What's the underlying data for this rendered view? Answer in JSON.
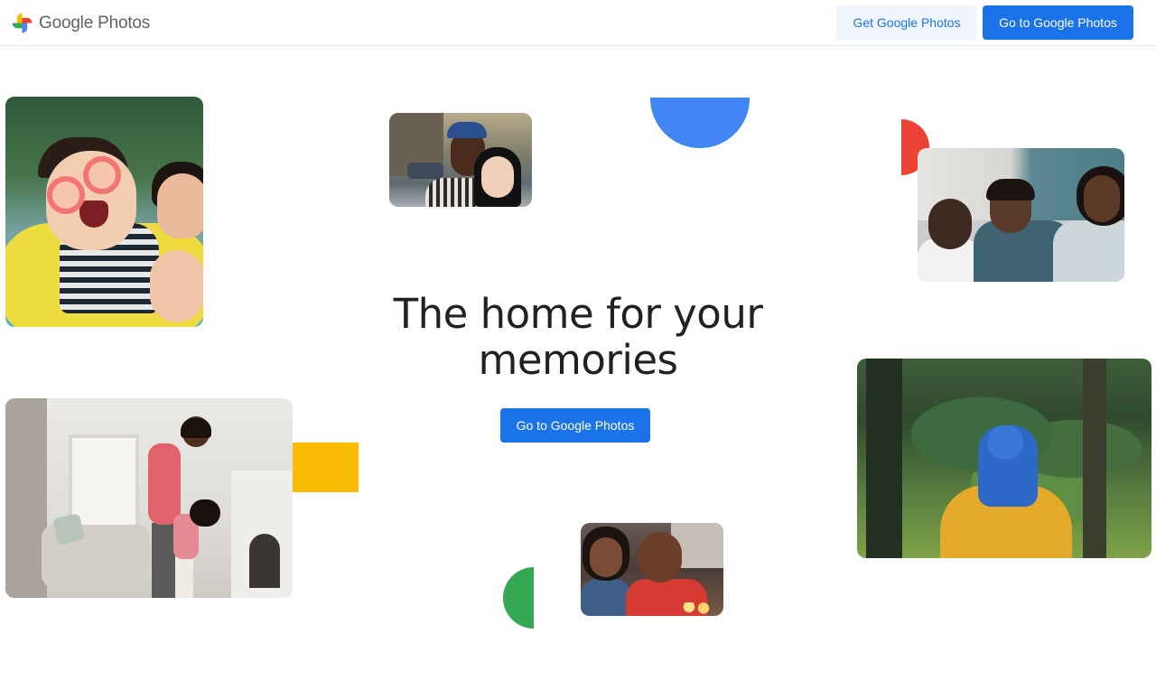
{
  "header": {
    "brand_name": "Google Photos",
    "get_button_label": "Get Google Photos",
    "go_button_label": "Go to Google Photos"
  },
  "hero": {
    "title": "The home for your memories",
    "cta_label": "Go to Google Photos"
  },
  "colors": {
    "blue": "#4285f4",
    "red": "#ea4335",
    "yellow": "#fbbc04",
    "green": "#34a853",
    "button_primary": "#1a73e8"
  },
  "icons": {
    "logo": "google-photos-pinwheel-icon"
  }
}
